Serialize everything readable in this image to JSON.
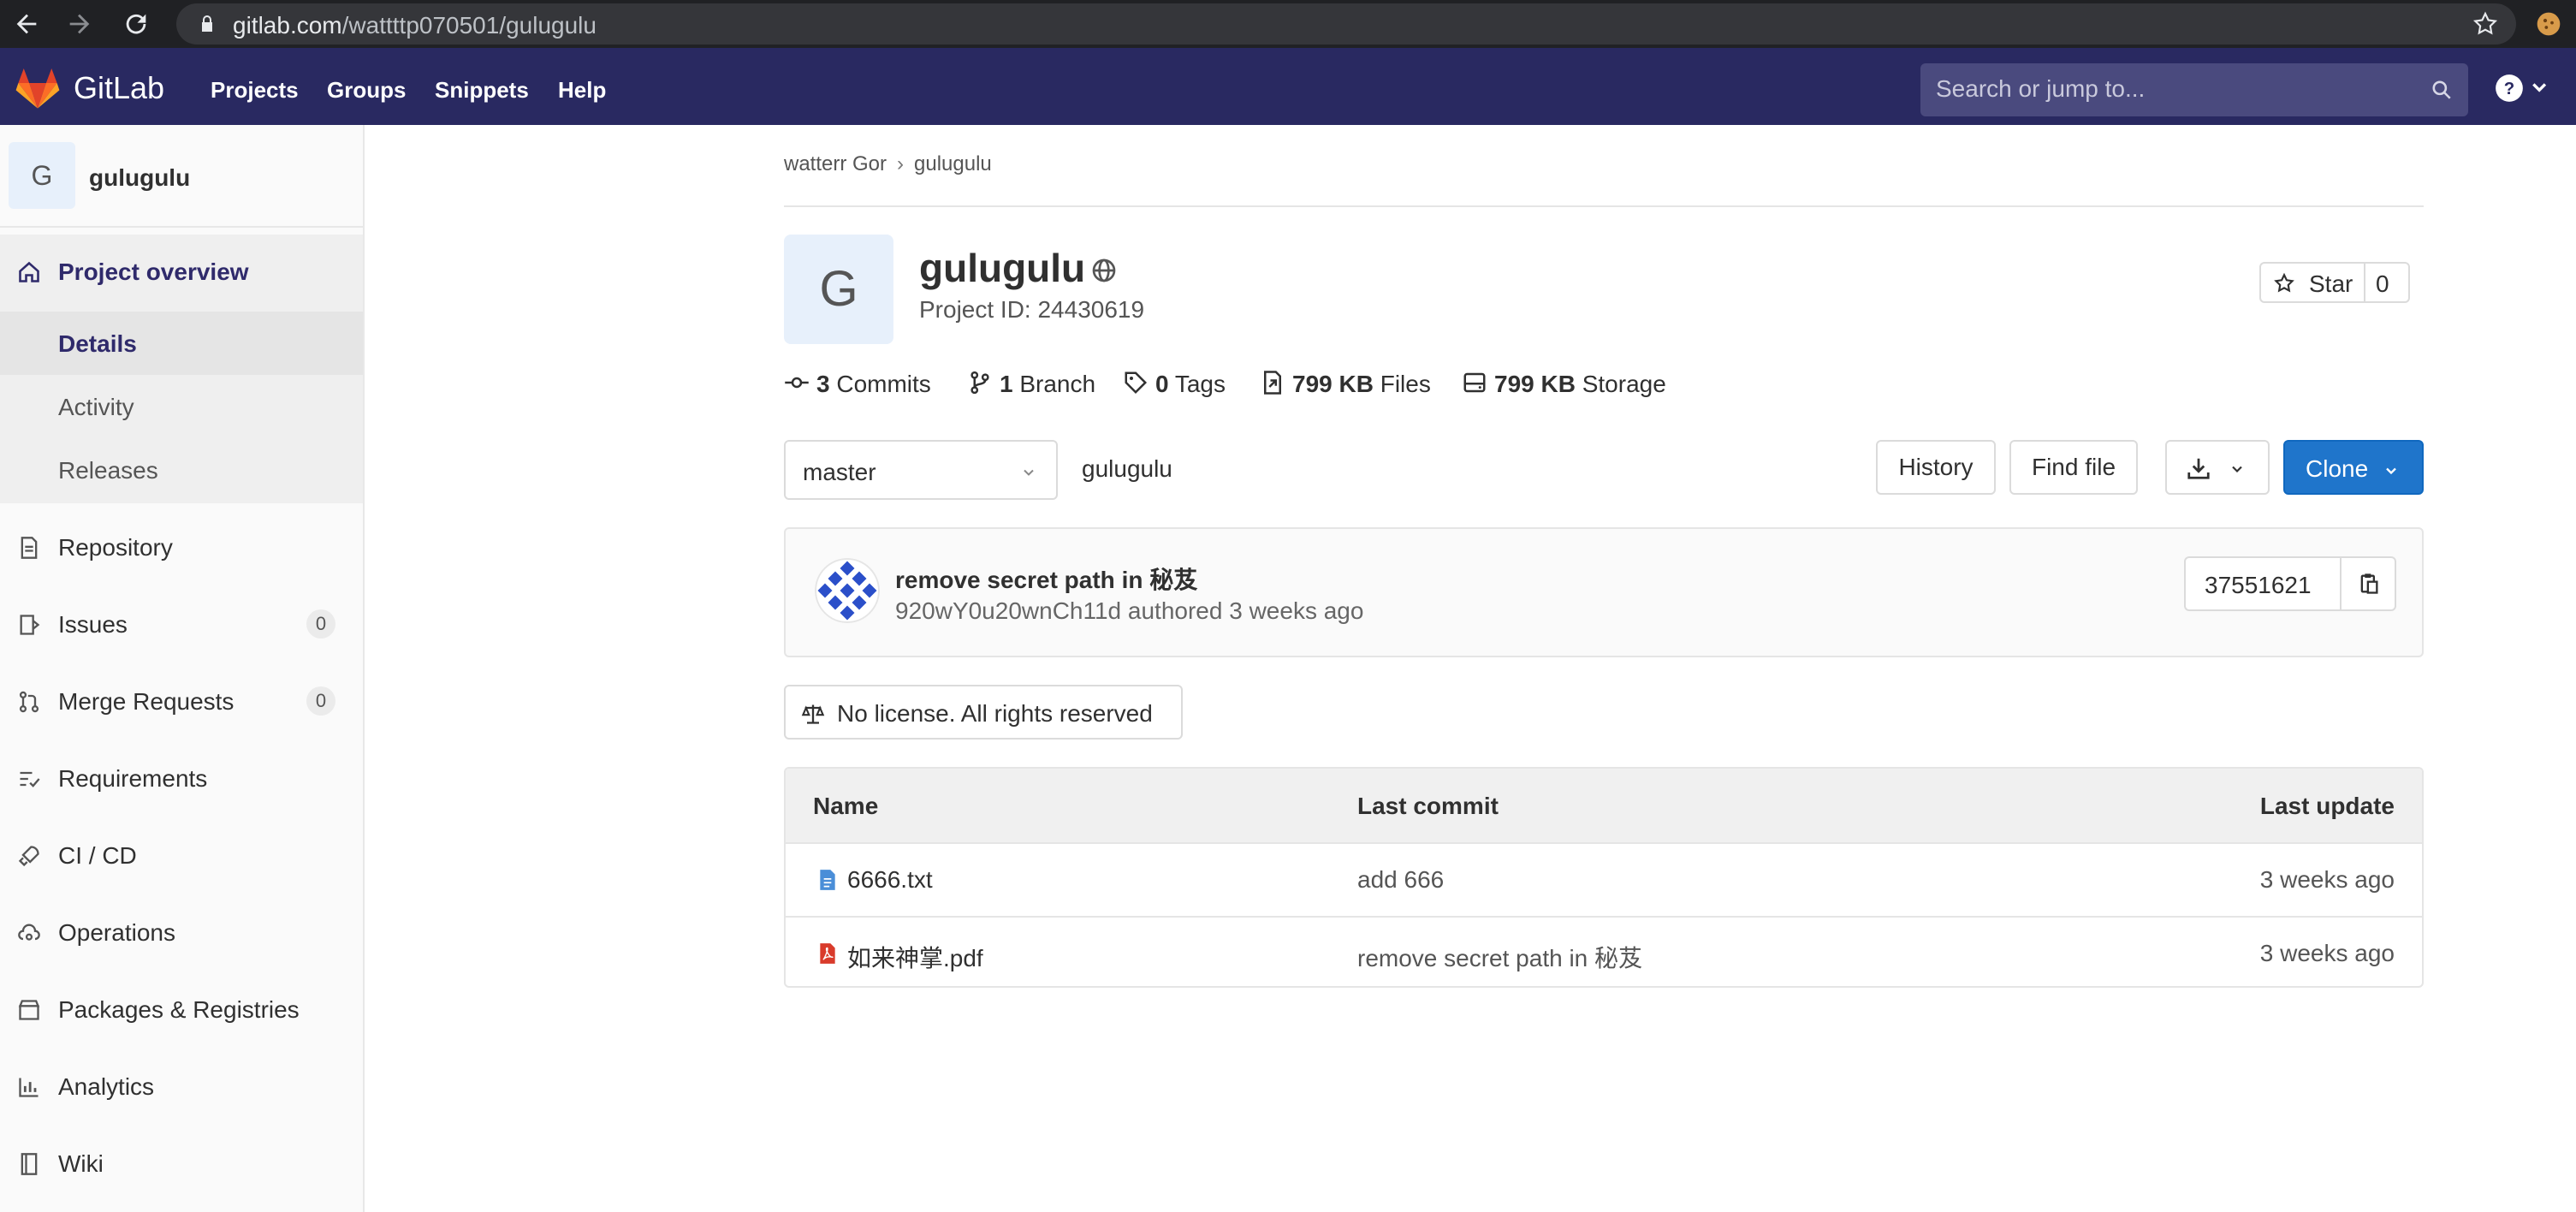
{
  "browser": {
    "url_host": "gitlab.com",
    "url_path": "/wattttp070501/gulugulu"
  },
  "header": {
    "brand": "GitLab",
    "nav": [
      "Projects",
      "Groups",
      "Snippets",
      "Help"
    ],
    "search_placeholder": "Search or jump to..."
  },
  "sidebar": {
    "project_avatar": "G",
    "project_name": "gulugulu",
    "overview": "Project overview",
    "sub_items": [
      "Details",
      "Activity",
      "Releases"
    ],
    "items": [
      {
        "label": "Repository",
        "icon": "document-icon"
      },
      {
        "label": "Issues",
        "icon": "issues-icon",
        "count": "0"
      },
      {
        "label": "Merge Requests",
        "icon": "merge-request-icon",
        "count": "0"
      },
      {
        "label": "Requirements",
        "icon": "requirements-icon"
      },
      {
        "label": "CI / CD",
        "icon": "rocket-icon"
      },
      {
        "label": "Operations",
        "icon": "cloud-gear-icon"
      },
      {
        "label": "Packages & Registries",
        "icon": "package-icon"
      },
      {
        "label": "Analytics",
        "icon": "chart-icon"
      },
      {
        "label": "Wiki",
        "icon": "book-icon"
      }
    ]
  },
  "breadcrumb": [
    "watterr Gor",
    "gulugulu"
  ],
  "project": {
    "avatar": "G",
    "title": "gulugulu",
    "id_text": "Project ID: 24430619",
    "star_label": "Star",
    "star_count": "0"
  },
  "stats": [
    {
      "value": "3",
      "label": "Commits"
    },
    {
      "value": "1",
      "label": "Branch"
    },
    {
      "value": "0",
      "label": "Tags"
    },
    {
      "value": "799 KB",
      "label": "Files"
    },
    {
      "value": "799 KB",
      "label": "Storage"
    }
  ],
  "toolbar": {
    "branch": "master",
    "path": "gulugulu",
    "history": "History",
    "find_file": "Find file",
    "clone": "Clone"
  },
  "last_commit": {
    "title": "remove secret path in 秘芨",
    "meta": "920wY0u20wnCh11d authored 3 weeks ago",
    "sha": "37551621"
  },
  "license": "No license. All rights reserved",
  "files": {
    "headers": [
      "Name",
      "Last commit",
      "Last update"
    ],
    "rows": [
      {
        "name": "6666.txt",
        "type": "text",
        "commit": "add 666",
        "updated": "3 weeks ago"
      },
      {
        "name": "如来神掌.pdf",
        "type": "pdf",
        "commit": "remove secret path in 秘芨",
        "updated": "3 weeks ago"
      }
    ]
  },
  "colors": {
    "header_bg": "#292961",
    "clone_blue": "#1f75cb",
    "active_nav": "#2f2a6b"
  }
}
